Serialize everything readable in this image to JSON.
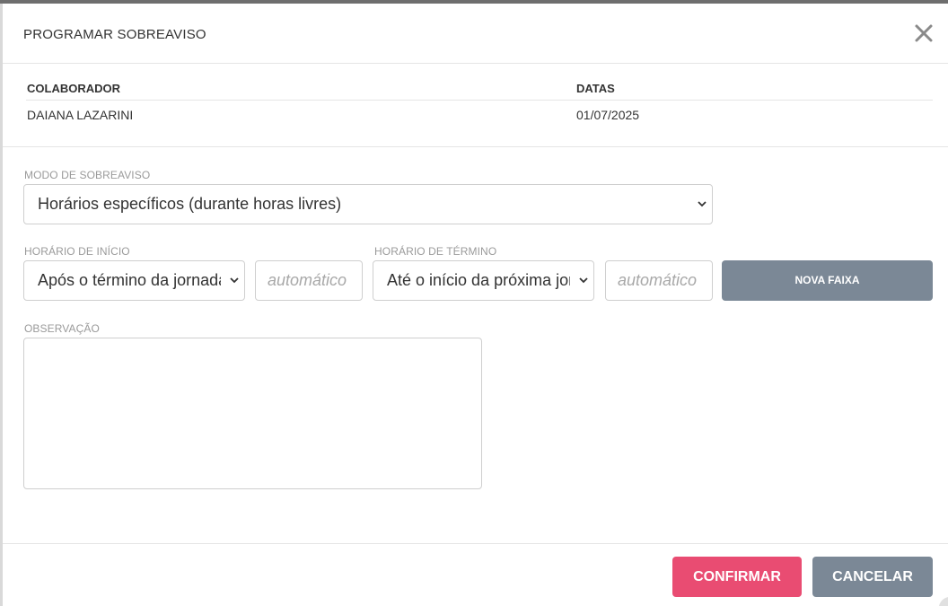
{
  "dialog": {
    "title": "PROGRAMAR SOBREAVISO"
  },
  "info": {
    "collaborator_label": "COLABORADOR",
    "collaborator_value": "DAIANA LAZARINI",
    "dates_label": "DATAS",
    "dates_value": "01/07/2025"
  },
  "form": {
    "mode_label": "MODO DE SOBREAVISO",
    "mode_value": "Horários específicos (durante horas livres)",
    "start_label": "HORÁRIO DE INÍCIO",
    "start_select_value": "Após o término da jornada",
    "start_time_placeholder": "automático",
    "end_label": "HORÁRIO DE TÉRMINO",
    "end_select_value": "Até o início da próxima jornada",
    "end_time_placeholder": "automático",
    "new_range_label": "NOVA FAIXA",
    "notes_label": "OBSERVAÇÃO"
  },
  "footer": {
    "confirm_label": "CONFIRMAR",
    "cancel_label": "CANCELAR"
  },
  "colors": {
    "confirm": "#e94c72",
    "secondary": "#7b8896"
  },
  "icons": {
    "close": "close-icon",
    "chevron": "chevron-down-icon"
  }
}
